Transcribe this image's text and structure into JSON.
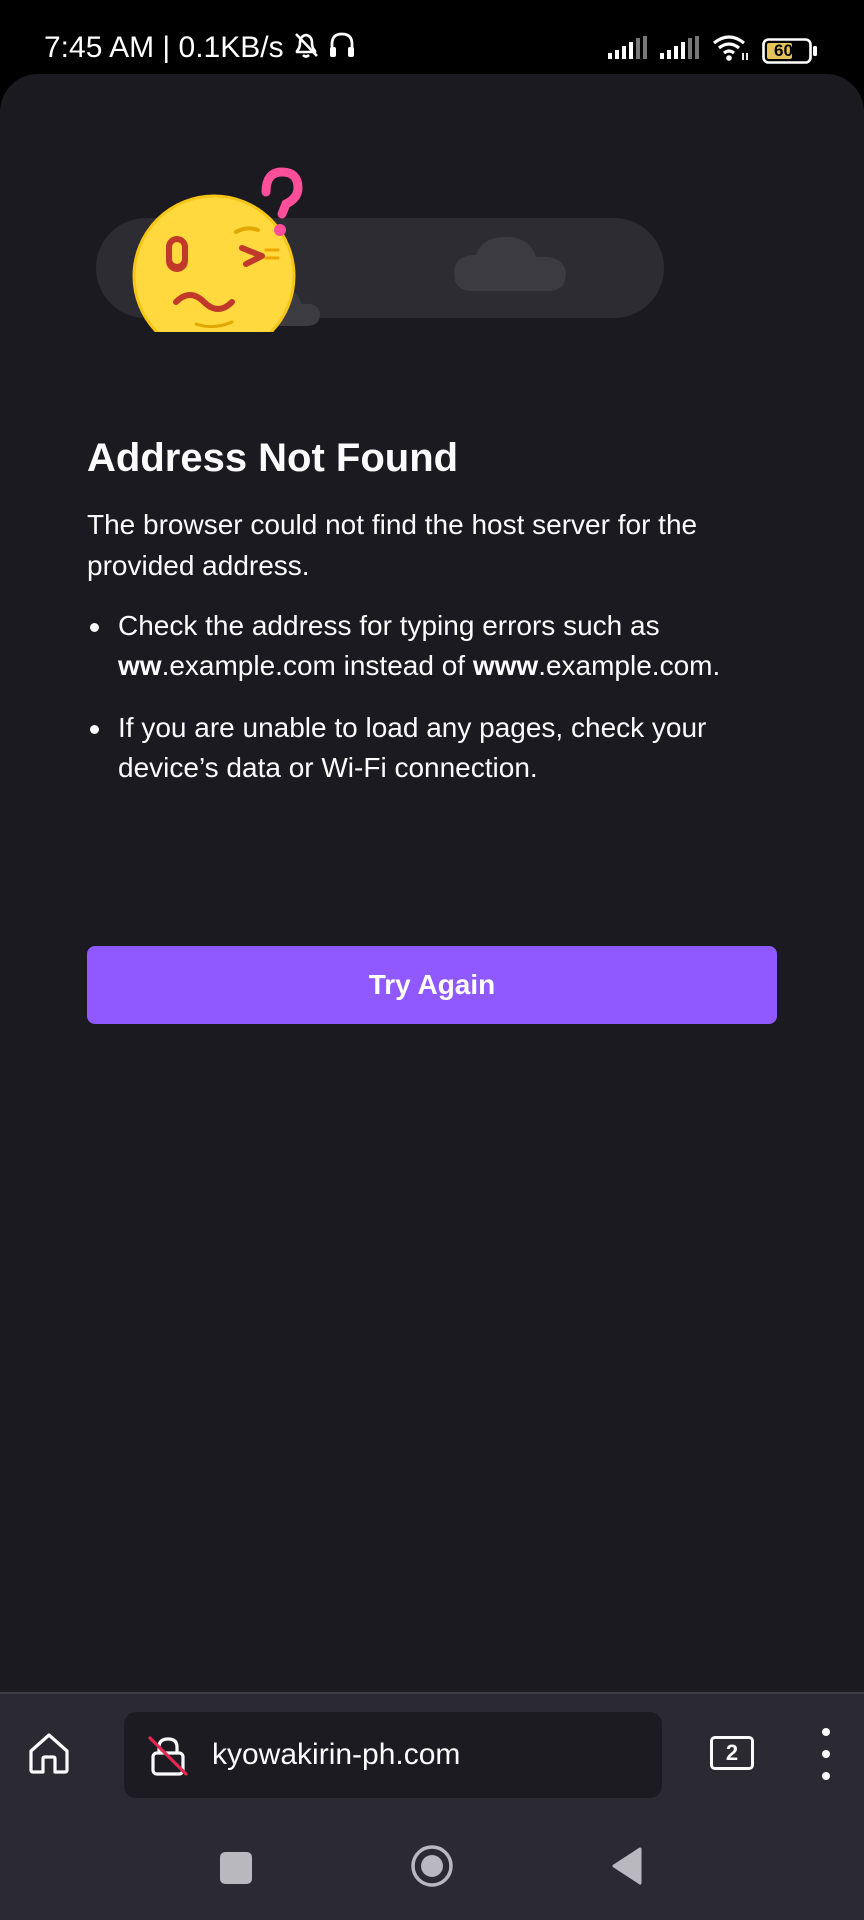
{
  "status_bar": {
    "time_speed": "7:45 AM | 0.1KB/s",
    "battery": "60",
    "icons": [
      "bell-muted-icon",
      "headset-icon",
      "signal-icon",
      "signal-icon",
      "wifi-icon",
      "battery-icon"
    ]
  },
  "error_page": {
    "illustration_icon": "confused-face-with-clouds",
    "title": "Address Not Found",
    "description": "The browser could not find the host server for the provided address.",
    "bullet1": {
      "prefix": "Check the address for typing errors such as ",
      "bad_bold": "ww",
      "bad_rest": ".example.com instead of ",
      "good_bold": "www",
      "good_rest": ".example.com."
    },
    "bullet2": "If you are unable to load any pages, check your device’s data or Wi-Fi connection.",
    "button_label": "Try Again",
    "button_color": "#9059ff"
  },
  "toolbar": {
    "url": "kyowakirin-ph.com",
    "tab_count": "2",
    "icons": [
      "home-icon",
      "insecure-lock-icon",
      "tabs-icon",
      "more-menu-icon"
    ]
  },
  "navbar": {
    "icons": [
      "recents-icon",
      "home-circle-icon",
      "back-icon"
    ]
  }
}
